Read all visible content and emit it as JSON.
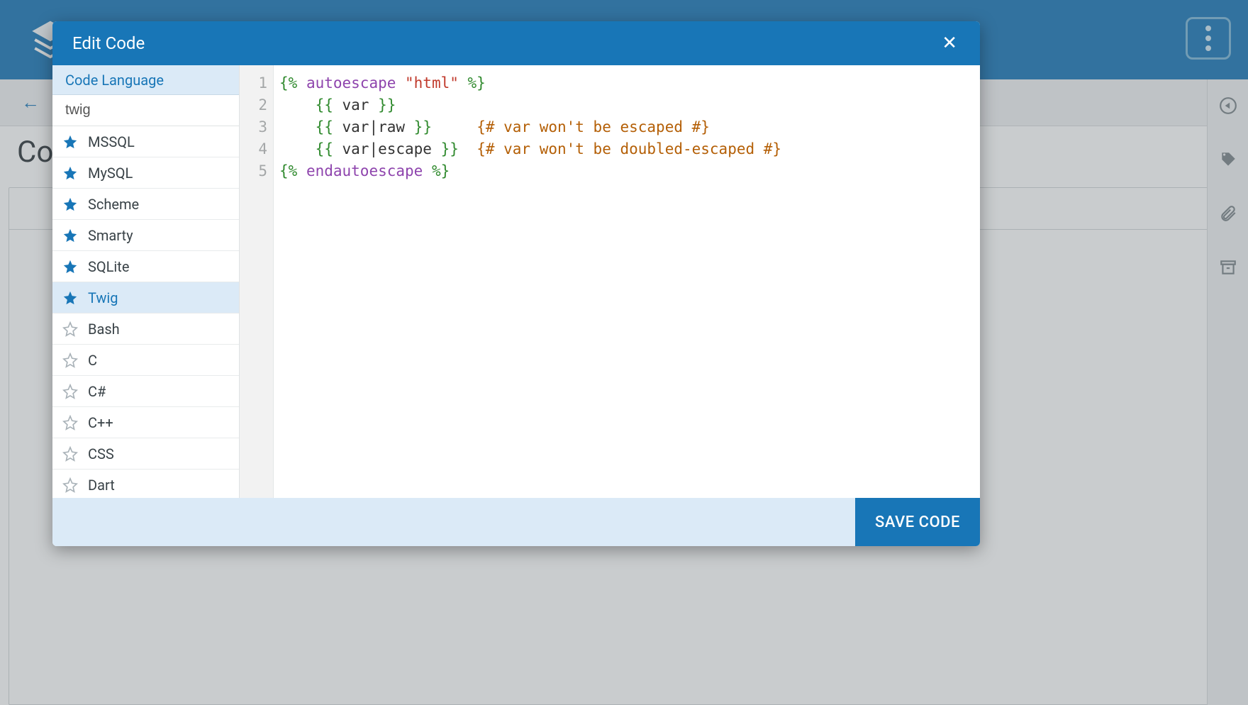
{
  "background": {
    "back_icon": "←",
    "page_title_fragment": "Co",
    "menu_button": "vertical-dots"
  },
  "right_rail": {
    "items": [
      "play-icon",
      "tag-icon",
      "attachment-icon",
      "archive-icon"
    ]
  },
  "modal": {
    "title": "Edit Code",
    "close_label": "✕",
    "sidebar_title": "Code Language",
    "search_value": "twig",
    "languages": [
      {
        "name": "MSSQL",
        "starred": true,
        "selected": false
      },
      {
        "name": "MySQL",
        "starred": true,
        "selected": false
      },
      {
        "name": "Scheme",
        "starred": true,
        "selected": false
      },
      {
        "name": "Smarty",
        "starred": true,
        "selected": false
      },
      {
        "name": "SQLite",
        "starred": true,
        "selected": false
      },
      {
        "name": "Twig",
        "starred": true,
        "selected": true
      },
      {
        "name": "Bash",
        "starred": false,
        "selected": false
      },
      {
        "name": "C",
        "starred": false,
        "selected": false
      },
      {
        "name": "C#",
        "starred": false,
        "selected": false
      },
      {
        "name": "C++",
        "starred": false,
        "selected": false
      },
      {
        "name": "CSS",
        "starred": false,
        "selected": false
      },
      {
        "name": "Dart",
        "starred": false,
        "selected": false
      }
    ],
    "code_lines": [
      {
        "n": 1,
        "tokens": [
          {
            "t": "{% ",
            "c": "tag"
          },
          {
            "t": "autoescape ",
            "c": "kw"
          },
          {
            "t": "\"html\"",
            "c": "str"
          },
          {
            "t": " %}",
            "c": "tag"
          }
        ]
      },
      {
        "n": 2,
        "tokens": [
          {
            "t": "    ",
            "c": "id"
          },
          {
            "t": "{{ ",
            "c": "tag"
          },
          {
            "t": "var",
            "c": "id"
          },
          {
            "t": " }}",
            "c": "tag"
          }
        ]
      },
      {
        "n": 3,
        "tokens": [
          {
            "t": "    ",
            "c": "id"
          },
          {
            "t": "{{ ",
            "c": "tag"
          },
          {
            "t": "var|raw",
            "c": "id"
          },
          {
            "t": " }}",
            "c": "tag"
          },
          {
            "t": "     ",
            "c": "id"
          },
          {
            "t": "{# var won't be escaped #}",
            "c": "cmnt"
          }
        ]
      },
      {
        "n": 4,
        "tokens": [
          {
            "t": "    ",
            "c": "id"
          },
          {
            "t": "{{ ",
            "c": "tag"
          },
          {
            "t": "var|escape",
            "c": "id"
          },
          {
            "t": " }}",
            "c": "tag"
          },
          {
            "t": "  ",
            "c": "id"
          },
          {
            "t": "{# var won't be doubled-escaped #}",
            "c": "cmnt"
          }
        ]
      },
      {
        "n": 5,
        "tokens": [
          {
            "t": "{% ",
            "c": "tag"
          },
          {
            "t": "endautoescape",
            "c": "kw"
          },
          {
            "t": " %}",
            "c": "tag"
          }
        ]
      }
    ],
    "save_label": "SAVE CODE"
  }
}
